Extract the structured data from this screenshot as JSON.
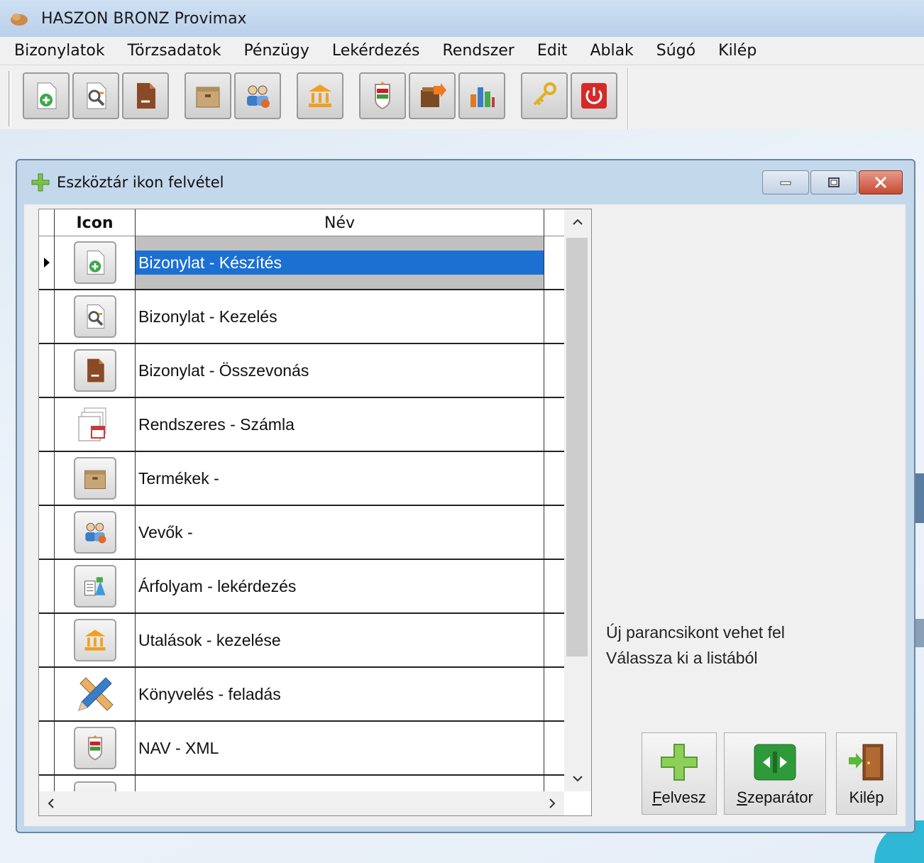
{
  "app": {
    "title": "HASZON BRONZ Provimax"
  },
  "menu": [
    "Bizonylatok",
    "Törzsadatok",
    "Pénzügy",
    "Lekérdezés",
    "Rendszer",
    "Edit",
    "Ablak",
    "Súgó",
    "Kilép"
  ],
  "toolbar": {
    "buttons": [
      "doc-add-icon",
      "doc-search-icon",
      "doc-merge-icon",
      "box-icon",
      "customers-icon",
      "bank-icon",
      "nav-xml-icon",
      "export-icon",
      "chart-icon",
      "key-icon",
      "power-icon"
    ]
  },
  "dialog": {
    "title": "Eszköztár ikon felvétel",
    "grid": {
      "columns": {
        "icon": "Icon",
        "name": "Név"
      },
      "rows": [
        {
          "name": "Bizonylat - Készítés",
          "icon": "doc-add-icon",
          "selected": true
        },
        {
          "name": "Bizonylat - Kezelés",
          "icon": "doc-search-icon"
        },
        {
          "name": "Bizonylat - Összevonás",
          "icon": "doc-merge-icon"
        },
        {
          "name": "Rendszeres - Számla",
          "icon": "recurring-invoice-icon"
        },
        {
          "name": "Termékek -",
          "icon": "box-icon"
        },
        {
          "name": "Vevők -",
          "icon": "customers-icon"
        },
        {
          "name": "Árfolyam - lekérdezés",
          "icon": "exchange-rate-icon"
        },
        {
          "name": "Utalások - kezelése",
          "icon": "bank-icon"
        },
        {
          "name": "Könyvelés - feladás",
          "icon": "pencil-ruler-icon"
        },
        {
          "name": "NAV - XML",
          "icon": "nav-xml-icon"
        },
        {
          "name": "",
          "icon": "export-icon"
        }
      ]
    },
    "hint": {
      "line1": "Új parancsikont vehet fel",
      "line2": "Válassza ki a listából"
    },
    "buttons": {
      "add": {
        "accel": "F",
        "rest": "elvesz"
      },
      "separator": {
        "accel": "S",
        "rest": "zeparátor"
      },
      "exit": {
        "label": "Kilép"
      }
    }
  }
}
